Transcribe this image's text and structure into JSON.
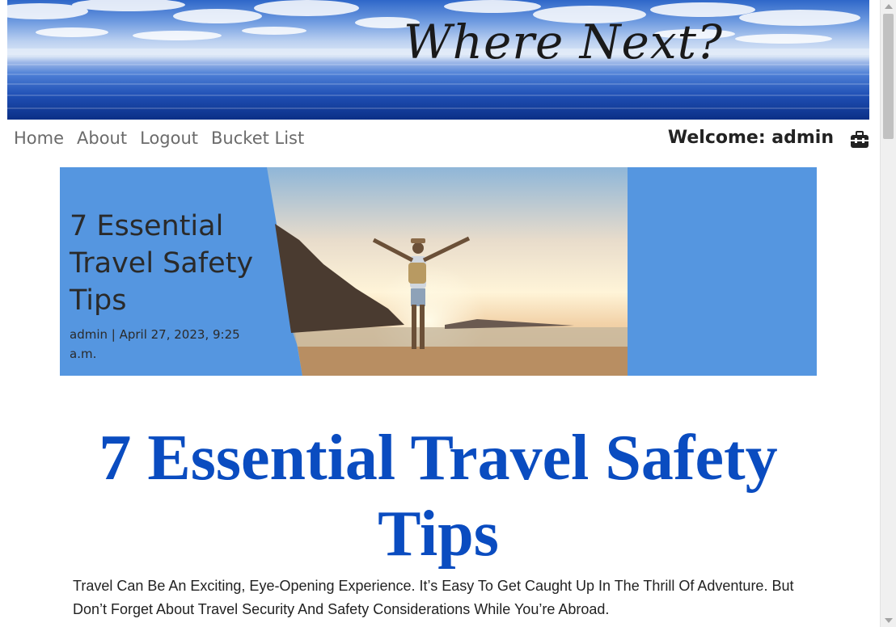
{
  "header": {
    "site_title": "Where Next?"
  },
  "nav": {
    "links": [
      {
        "label": "Home"
      },
      {
        "label": "About"
      },
      {
        "label": "Logout"
      },
      {
        "label": "Bucket List"
      }
    ],
    "welcome_text": "Welcome: admin",
    "toolbox_icon": "toolbox-icon"
  },
  "hero": {
    "title": "7 Essential Travel Safety Tips",
    "meta": "admin | April 27, 2023, 9:25 a.m.",
    "background_color": "#5596e0"
  },
  "article": {
    "title": "7 Essential Travel Safety Tips",
    "intro": "Travel Can Be An Exciting, Eye-Opening Experience. It’s Easy To Get Caught Up In The Thrill Of Adventure. But Don’t Forget About Travel Security And Safety Considerations While You’re Abroad.",
    "title_color": "#0a4cc0"
  }
}
